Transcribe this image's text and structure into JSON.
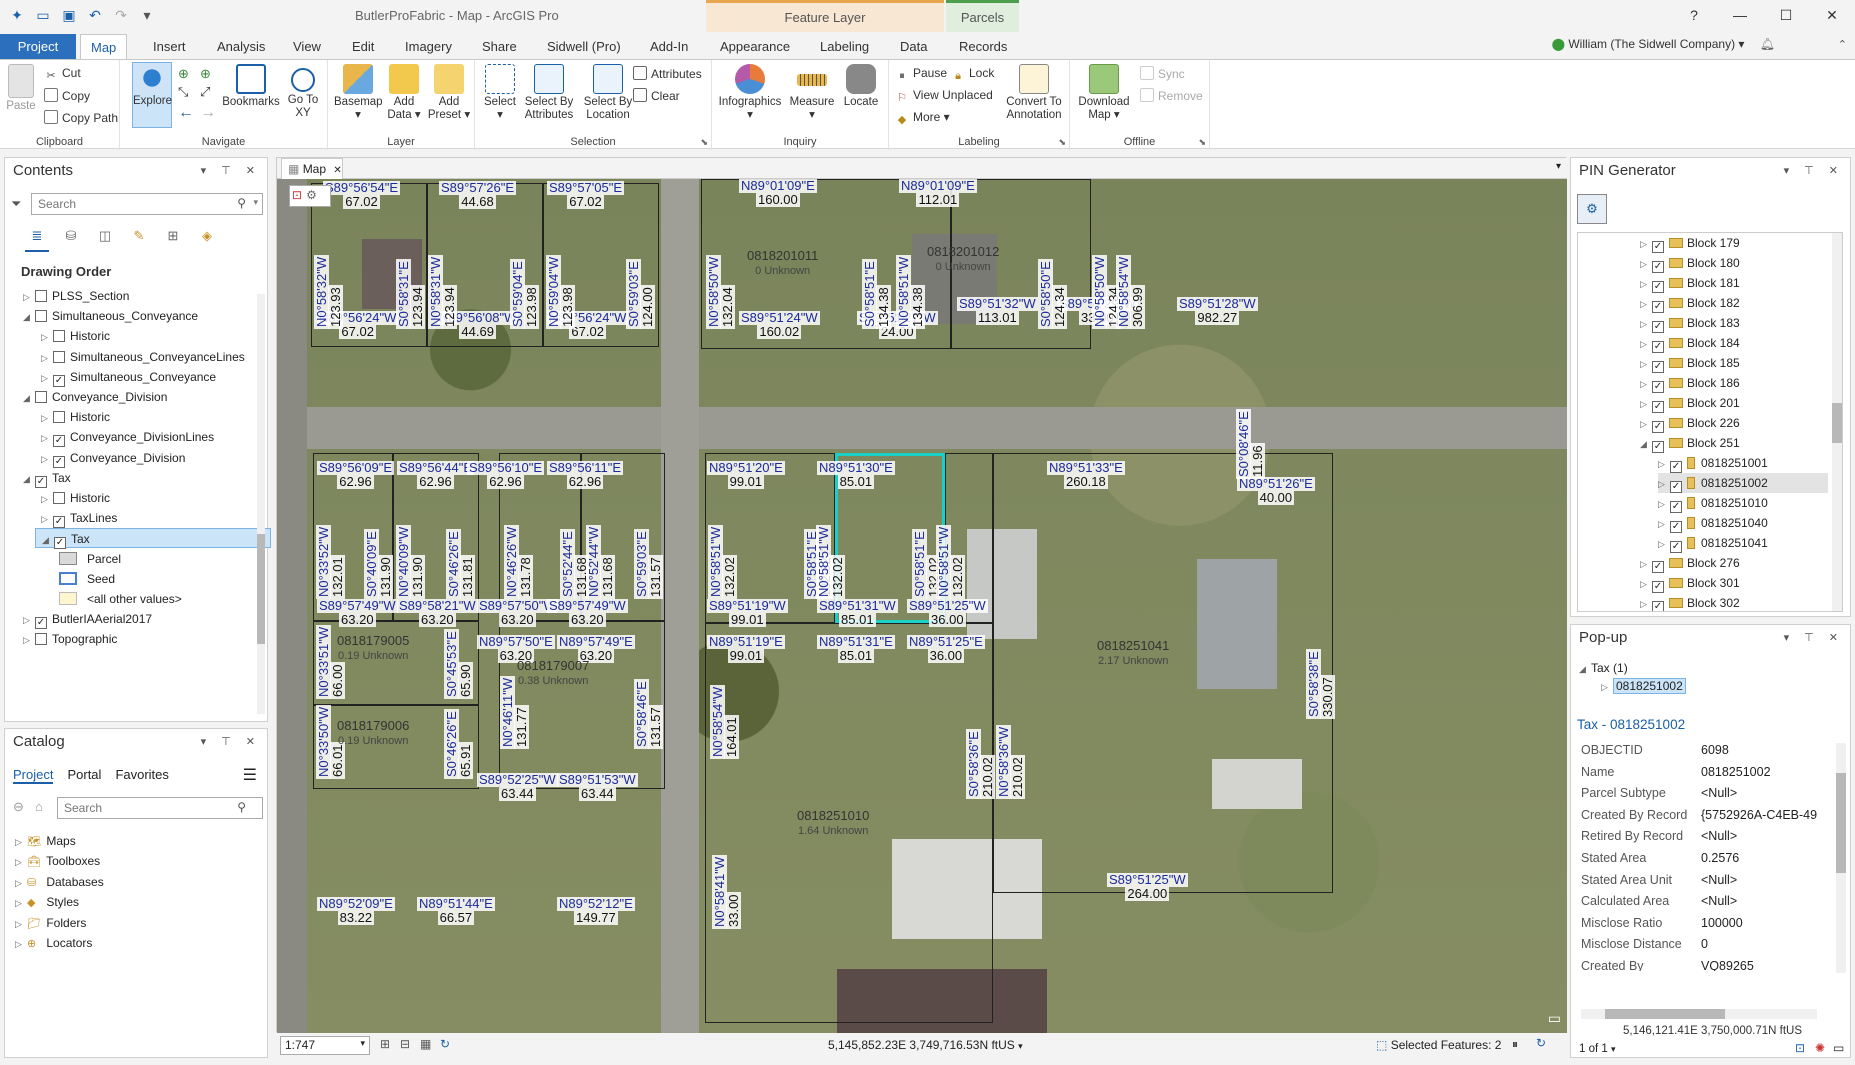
{
  "titlebar": {
    "title": "ButlerProFabric - Map - ArcGIS Pro",
    "ctx1": "Feature Layer",
    "ctx2": "Parcels",
    "help": "?"
  },
  "tabs": [
    {
      "label": "Project"
    },
    {
      "label": "Map"
    },
    {
      "label": "Insert"
    },
    {
      "label": "Analysis"
    },
    {
      "label": "View"
    },
    {
      "label": "Edit"
    },
    {
      "label": "Imagery"
    },
    {
      "label": "Share"
    },
    {
      "label": "Sidwell (Pro)"
    },
    {
      "label": "Add-In"
    },
    {
      "label": "Appearance"
    },
    {
      "label": "Labeling"
    },
    {
      "label": "Data"
    },
    {
      "label": "Records"
    }
  ],
  "user": "William (The Sidwell Company) ▾",
  "ribbon": {
    "clipboard": {
      "label": "Clipboard",
      "paste": "Paste",
      "cut": "Cut",
      "copy": "Copy",
      "copy_path": "Copy Path"
    },
    "navigate": {
      "label": "Navigate",
      "explore": "Explore",
      "bookmarks": "Bookmarks",
      "goto": "Go To XY"
    },
    "layer": {
      "label": "Layer",
      "basemap": "Basemap",
      "add_data": "Add Data",
      "add_preset": "Add Preset"
    },
    "selection": {
      "label": "Selection",
      "select": "Select",
      "by_attr": "Select By Attributes",
      "by_loc": "Select By Location",
      "attributes": "Attributes",
      "clear": "Clear"
    },
    "inquiry": {
      "label": "Inquiry",
      "infographics": "Infographics",
      "measure": "Measure",
      "locate": "Locate"
    },
    "labeling": {
      "label": "Labeling",
      "pause": "Pause",
      "lock": "Lock",
      "view_unplaced": "View Unplaced",
      "more": "More",
      "convert": "Convert To Annotation"
    },
    "offline": {
      "label": "Offline",
      "download": "Download Map",
      "sync": "Sync",
      "remove": "Remove"
    }
  },
  "contents": {
    "title": "Contents",
    "search_placeholder": "Search",
    "drawing_order": "Drawing Order",
    "items": [
      {
        "label": "PLSS_Section",
        "checked": false,
        "indent": 0
      },
      {
        "label": "Simultaneous_Conveyance",
        "checked": false,
        "indent": 0
      },
      {
        "label": "Historic",
        "checked": false,
        "indent": 1
      },
      {
        "label": "Simultaneous_ConveyanceLines",
        "checked": false,
        "indent": 1
      },
      {
        "label": "Simultaneous_Conveyance",
        "checked": true,
        "indent": 1
      },
      {
        "label": "Conveyance_Division",
        "checked": false,
        "indent": 0
      },
      {
        "label": "Historic",
        "checked": false,
        "indent": 1
      },
      {
        "label": "Conveyance_DivisionLines",
        "checked": true,
        "indent": 1
      },
      {
        "label": "Conveyance_Division",
        "checked": true,
        "indent": 1
      },
      {
        "label": "Tax",
        "checked": true,
        "indent": 0
      },
      {
        "label": "Historic",
        "checked": false,
        "indent": 1
      },
      {
        "label": "TaxLines",
        "checked": true,
        "indent": 1
      },
      {
        "label": "Tax",
        "checked": true,
        "indent": 1
      },
      {
        "label": "Parcel",
        "checked": null,
        "indent": 2
      },
      {
        "label": "Seed",
        "checked": null,
        "indent": 2
      },
      {
        "label": "<all other values>",
        "checked": null,
        "indent": 2
      },
      {
        "label": "ButlerIAAerial2017",
        "checked": true,
        "indent": 0
      },
      {
        "label": "Topographic",
        "checked": false,
        "indent": 0
      }
    ]
  },
  "catalog": {
    "title": "Catalog",
    "tabs": [
      "Project",
      "Portal",
      "Favorites"
    ],
    "search_placeholder": "Search",
    "items": [
      "Maps",
      "Toolboxes",
      "Databases",
      "Styles",
      "Folders",
      "Locators"
    ]
  },
  "map": {
    "tab": "Map",
    "scale": "1:747",
    "coords": "5,145,852.23E 3,749,716.53N ftUS",
    "selected": "Selected Features: 2"
  },
  "pin_generator": {
    "title": "PIN Generator",
    "items": [
      {
        "label": "Block 179",
        "level": 0,
        "expanded": false
      },
      {
        "label": "Block 180",
        "level": 0,
        "expanded": false
      },
      {
        "label": "Block 181",
        "level": 0,
        "expanded": false
      },
      {
        "label": "Block 182",
        "level": 0,
        "expanded": false
      },
      {
        "label": "Block 183",
        "level": 0,
        "expanded": false
      },
      {
        "label": "Block 184",
        "level": 0,
        "expanded": false
      },
      {
        "label": "Block 185",
        "level": 0,
        "expanded": false
      },
      {
        "label": "Block 186",
        "level": 0,
        "expanded": false
      },
      {
        "label": "Block 201",
        "level": 0,
        "expanded": false
      },
      {
        "label": "Block 226",
        "level": 0,
        "expanded": false
      },
      {
        "label": "Block 251",
        "level": 0,
        "expanded": true
      },
      {
        "label": "0818251001",
        "level": 1,
        "expanded": false
      },
      {
        "label": "0818251002",
        "level": 1,
        "expanded": false
      },
      {
        "label": "0818251010",
        "level": 1,
        "expanded": false
      },
      {
        "label": "0818251040",
        "level": 1,
        "expanded": false
      },
      {
        "label": "0818251041",
        "level": 1,
        "expanded": false
      },
      {
        "label": "Block 276",
        "level": 0,
        "expanded": false
      },
      {
        "label": "Block 301",
        "level": 0,
        "expanded": false
      },
      {
        "label": "Block 302",
        "level": 0,
        "expanded": false
      }
    ]
  },
  "popup": {
    "title": "Pop-up",
    "layer": "Tax",
    "count": "(1)",
    "feature": "0818251002",
    "heading": "Tax - 0818251002",
    "fields": [
      {
        "k": "OBJECTID",
        "v": "6098"
      },
      {
        "k": "Name",
        "v": "0818251002"
      },
      {
        "k": "Parcel Subtype",
        "v": "<Null>"
      },
      {
        "k": "Created By Record",
        "v": "{5752926A-C4EB-49"
      },
      {
        "k": "Retired By Record",
        "v": "<Null>"
      },
      {
        "k": "Stated Area",
        "v": "0.2576"
      },
      {
        "k": "Stated Area Unit",
        "v": "<Null>"
      },
      {
        "k": "Calculated Area",
        "v": "<Null>"
      },
      {
        "k": "Misclose Ratio",
        "v": "100000"
      },
      {
        "k": "Misclose Distance",
        "v": "0"
      },
      {
        "k": "Created By",
        "v": "VQ89265"
      }
    ],
    "coords": "5,146,121.41E 3,750,000.71N ftUS",
    "pager": "1 of 1"
  },
  "map_labels": {
    "h": [
      {
        "t": "S89°56'54\"E",
        "n": "67.02"
      },
      {
        "t": "S89°57'26\"E",
        "n": "44.68"
      },
      {
        "t": "S89°57'05\"E",
        "n": "67.02"
      },
      {
        "t": "N89°01'09\"E",
        "n": "160.00"
      },
      {
        "t": "N89°01'09\"E",
        "n": "112.01"
      },
      {
        "t": "N89°56'24\"W",
        "n": "67.02"
      },
      {
        "t": "N89°56'08\"W",
        "n": "44.69"
      },
      {
        "t": "N89°56'24\"W",
        "n": "67.02"
      },
      {
        "t": "S89°51'24\"W",
        "n": "160.02"
      },
      {
        "t": "S89°51'27\"W",
        "n": "24.00"
      },
      {
        "t": "S89°51'32\"W",
        "n": "113.01"
      },
      {
        "t": "S89°51'29\"W",
        "n": "33.00"
      },
      {
        "t": "S89°51'28\"W",
        "n": "982.27"
      },
      {
        "t": "S89°56'09\"E",
        "n": "62.96"
      },
      {
        "t": "S89°56'44\"E",
        "n": "62.96"
      },
      {
        "t": "S89°56'10\"E",
        "n": "62.96"
      },
      {
        "t": "S89°56'11\"E",
        "n": "62.96"
      },
      {
        "t": "N89°51'20\"E",
        "n": "99.01"
      },
      {
        "t": "N89°51'30\"E",
        "n": "85.01"
      },
      {
        "t": "N89°51'33\"E",
        "n": "260.18"
      },
      {
        "t": "N89°51'26\"E",
        "n": "40.00"
      },
      {
        "t": "S89°57'49\"W",
        "n": "63.20"
      },
      {
        "t": "S89°58'21\"W",
        "n": "63.20"
      },
      {
        "t": "S89°57'50\"W",
        "n": "63.20"
      },
      {
        "t": "S89°57'49\"W",
        "n": "63.20"
      },
      {
        "t": "S89°51'19\"W",
        "n": "99.01"
      },
      {
        "t": "S89°51'31\"W",
        "n": "85.01"
      },
      {
        "t": "S89°51'25\"W",
        "n": "36.00"
      },
      {
        "t": "N89°51'19\"E",
        "n": "99.01"
      },
      {
        "t": "N89°51'31\"E",
        "n": "85.01"
      },
      {
        "t": "N89°51'25\"E",
        "n": "36.00"
      },
      {
        "t": "N89°57'50\"E",
        "n": "63.20"
      },
      {
        "t": "N89°57'49\"E",
        "n": "63.20"
      },
      {
        "t": "S89°52'25\"W",
        "n": "63.44"
      },
      {
        "t": "S89°51'53\"W",
        "n": "63.44"
      },
      {
        "t": "S89°51'25\"W",
        "n": "264.00"
      },
      {
        "t": "N89°52'09\"E",
        "n": "83.22"
      },
      {
        "t": "N89°51'44\"E",
        "n": "66.57"
      },
      {
        "t": "N89°52'12\"E",
        "n": "149.77"
      }
    ],
    "v": [
      {
        "t": "N0°58'32\"W",
        "n": "123.93"
      },
      {
        "t": "S0°58'31\"E",
        "n": "123.94"
      },
      {
        "t": "N0°58'31\"W",
        "n": "123.94"
      },
      {
        "t": "S0°59'04\"E",
        "n": "123.98"
      },
      {
        "t": "N0°59'04\"W",
        "n": "123.98"
      },
      {
        "t": "S0°59'03\"E",
        "n": "124.00"
      },
      {
        "t": "N0°58'50\"W",
        "n": "132.04"
      },
      {
        "t": "S0°58'51\"E",
        "n": "134.38"
      },
      {
        "t": "N0°58'51\"W",
        "n": "134.38"
      },
      {
        "t": "S0°58'50\"E",
        "n": "124.34"
      },
      {
        "t": "N0°58'50\"W",
        "n": "124.34"
      },
      {
        "t": "N0°58'54\"W",
        "n": "306.99"
      },
      {
        "t": "S0°08'46\"E",
        "n": "11.96"
      },
      {
        "t": "N0°33'52\"W",
        "n": "132.01"
      },
      {
        "t": "S0°40'09\"E",
        "n": "131.90"
      },
      {
        "t": "N0°40'09\"W",
        "n": "131.90"
      },
      {
        "t": "S0°46'26\"E",
        "n": "131.81"
      },
      {
        "t": "N0°46'26\"W",
        "n": "131.78"
      },
      {
        "t": "S0°52'44\"E",
        "n": "131.68"
      },
      {
        "t": "N0°52'44\"W",
        "n": "131.68"
      },
      {
        "t": "S0°59'03\"E",
        "n": "131.57"
      },
      {
        "t": "N0°58'51\"W",
        "n": "132.02"
      },
      {
        "t": "S0°58'51\"E",
        "n": "132.02"
      },
      {
        "t": "N0°58'51\"W",
        "n": "132.02"
      },
      {
        "t": "S0°58'51\"E",
        "n": "132.02"
      },
      {
        "t": "N0°58'51\"W",
        "n": "132.02"
      },
      {
        "t": "N0°33'51\"W",
        "n": "66.00"
      },
      {
        "t": "S0°45'53\"E",
        "n": "65.90"
      },
      {
        "t": "N0°46'11\"W",
        "n": "131.77"
      },
      {
        "t": "S0°58'46\"E",
        "n": "131.57"
      },
      {
        "t": "N0°33'50\"W",
        "n": "66.01"
      },
      {
        "t": "S0°46'26\"E",
        "n": "65.91"
      },
      {
        "t": "N0°58'54\"W",
        "n": "164.01"
      },
      {
        "t": "S0°58'36\"E",
        "n": "210.02"
      },
      {
        "t": "N0°58'36\"W",
        "n": "210.02"
      },
      {
        "t": "S0°58'38\"E",
        "n": "330.07"
      },
      {
        "t": "N0°58'41\"W",
        "n": "33.00"
      }
    ],
    "pins": [
      {
        "pin": "0818201011",
        "sub": "0 Unknown"
      },
      {
        "pin": "0818201012",
        "sub": "0 Unknown"
      },
      {
        "pin": "0818179005",
        "sub": "0.19 Unknown"
      },
      {
        "pin": "0818179007",
        "sub": "0.38 Unknown"
      },
      {
        "pin": "0818179006",
        "sub": "0.19 Unknown"
      },
      {
        "pin": "0818251041",
        "sub": "2.17 Unknown"
      },
      {
        "pin": "0818251010",
        "sub": "1.64 Unknown"
      }
    ]
  }
}
